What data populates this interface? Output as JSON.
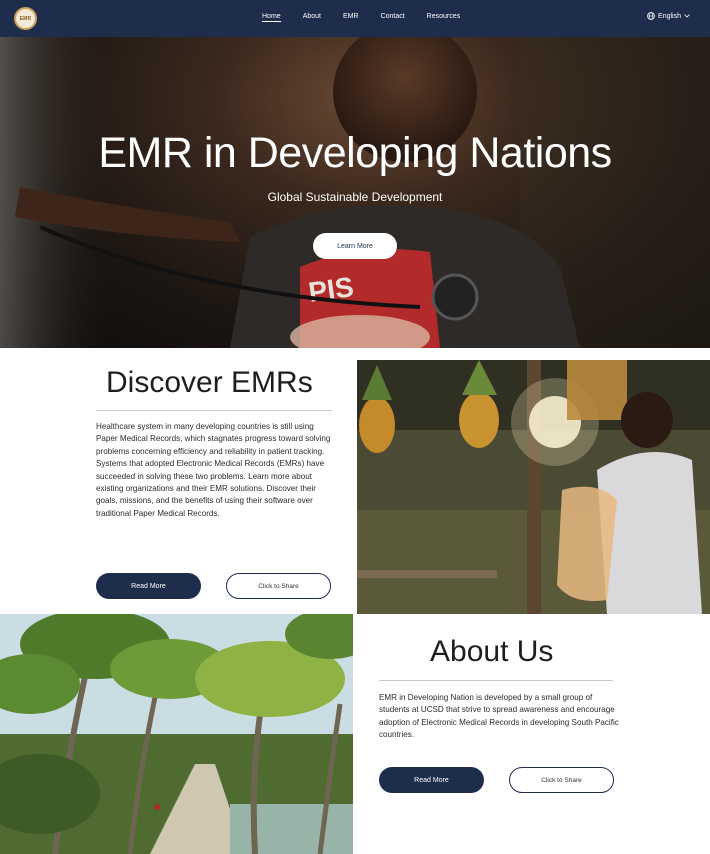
{
  "nav": {
    "logo_text": "EMR",
    "links": [
      "Home",
      "About",
      "EMR",
      "Contact",
      "Resources"
    ],
    "language": "English"
  },
  "hero": {
    "title": "EMR in Developing Nations",
    "subtitle": "Global Sustainable Development",
    "button": "Learn More",
    "shirt_text": "PIS"
  },
  "discover": {
    "title": "Discover EMRs",
    "body": "Healthcare system in many developing countries is still using Paper Medical Records, which stagnates progress toward solving problems concerning efficiency and reliability in patient tracking. Systems that adopted Electronic Medical Records (EMRs) have succeeded in solving these two problems. Learn more about existing organizations and their EMR solutions. Discover their goals, missions, and the benefits of using their software over traditional Paper Medical Records.",
    "read_more": "Read More",
    "share": "Click to Share"
  },
  "about": {
    "title": "About Us",
    "body": "EMR in Developing Nation is developed by a small group of students at UCSD that strive to spread awareness and encourage adoption of Electronic Medical Records in developing South Pacific countries.",
    "read_more": "Read More",
    "share": "Click to Share"
  },
  "colors": {
    "navy": "#1f2d4d",
    "white": "#ffffff"
  }
}
